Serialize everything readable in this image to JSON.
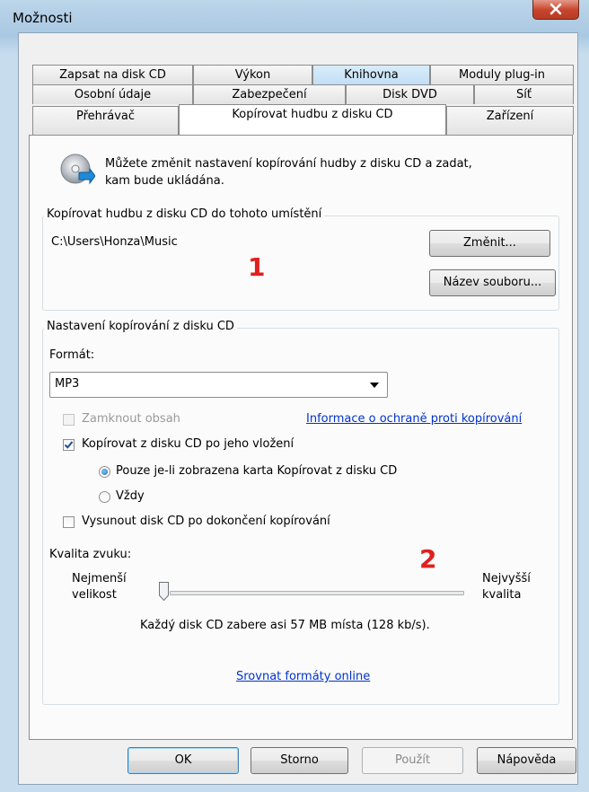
{
  "window": {
    "title": "Možnosti",
    "close_label": "x"
  },
  "tabs": {
    "row1": [
      "Zapsat na disk CD",
      "Výkon",
      "Knihovna",
      "Moduly plug-in"
    ],
    "row2": [
      "Osobní údaje",
      "Zabezpečení",
      "Disk DVD",
      "Síť"
    ],
    "row3": [
      "Přehrávač",
      "Kopírovat hudbu z disku CD",
      "Zařízení"
    ]
  },
  "intro": {
    "text_line1": "Můžete změnit nastavení kopírování hudby z disku CD a zadat,",
    "text_line2": "kam bude ukládána."
  },
  "location_group": {
    "label": "Kopírovat hudbu z disku CD do tohoto umístění",
    "path": "C:\\Users\\Honza\\Music",
    "change_button": "Změnit...",
    "filename_button": "Název souboru..."
  },
  "settings_group": {
    "label": "Nastavení kopírování z disku CD",
    "format_label": "Formát:",
    "format_value": "MP3",
    "protect_label": "Zamknout obsah",
    "protect_checked": false,
    "protect_enabled": false,
    "protect_info_link": "Informace o ochraně proti kopírování",
    "rip_on_insert_label": "Kopírovat z disku CD po jeho vložení",
    "rip_on_insert_checked": true,
    "radio_only_tab": "Pouze je-li zobrazena karta Kopírovat z disku CD",
    "radio_always": "Vždy",
    "radio_selected": "only_tab",
    "eject_label": "Vysunout disk CD po dokončení kopírování",
    "eject_checked": false,
    "quality_label": "Kvalita zvuku:",
    "quality_min_line1": "Nejmenší",
    "quality_min_line2": "velikost",
    "quality_max_line1": "Nejvyšší",
    "quality_max_line2": "kvalita",
    "quality_level_fraction": 0.0,
    "quality_info": "Každý disk CD zabere asi 57 MB místa (128 kb/s).",
    "compare_link": "Srovnat formáty online"
  },
  "annotations": [
    "1",
    "2"
  ],
  "buttons": {
    "ok": "OK",
    "cancel": "Storno",
    "apply": "Použít",
    "help": "Nápověda"
  },
  "colors": {
    "link": "#0033cc",
    "annotation": "#e02020",
    "selected_tab_highlight": "#c2def5"
  }
}
